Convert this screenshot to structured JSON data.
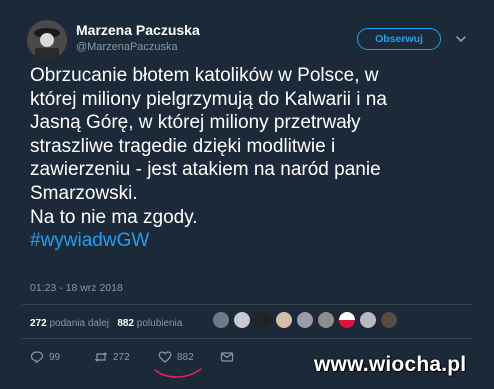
{
  "author": {
    "name": "Marzena Paczuska",
    "handle": "@MarzenaPaczuska",
    "avatar_icon": "profile-photo"
  },
  "header": {
    "follow_label": "Obserwuj",
    "menu_icon": "chevron-down-icon"
  },
  "tweet": {
    "lines": [
      "Obrzucanie błotem katolików w Polsce, w",
      "której miliony pielgrzymują do Kalwarii i na",
      "Jasną Górę, w której miliony przetrwały",
      "straszliwe tragedie dzięki modlitwie i",
      "zawierzeniu - jest atakiem na naród panie",
      "Smarzowski.",
      "Na to nie ma zgody."
    ],
    "hashtag": "#wywiadwGW",
    "timestamp": "01:23 - 18 wrz 2018"
  },
  "stats": {
    "retweets_count": "272",
    "retweets_label": "podania dalej",
    "likes_count": "882",
    "likes_label": "polubienia"
  },
  "actions": {
    "reply_count": "99",
    "retweet_count": "272",
    "like_count": "882"
  },
  "colors": {
    "background": "#1c2938",
    "accent": "#1da1f2",
    "secondary_text": "#8899a6",
    "like_underline": "#e0245e"
  },
  "watermark": "www.wiocha.pl"
}
